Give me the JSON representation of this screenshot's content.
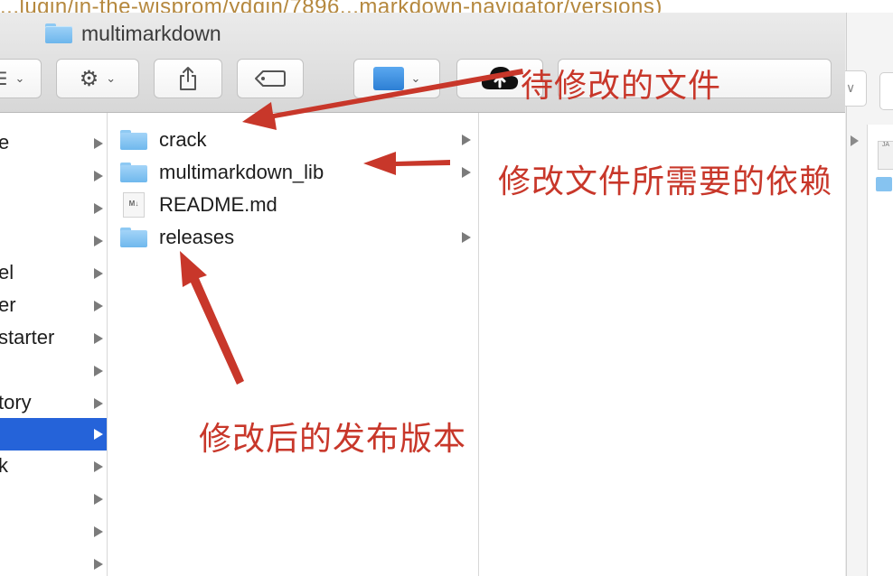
{
  "background": {
    "url_text": "...lugin/in-the-wisprom/ydqin/7896...markdown-navigator/versions)",
    "right_button_glyph": "∨",
    "jar_label": "JA"
  },
  "window": {
    "title": "multimarkdown",
    "toolbar": {
      "view_glyph": "☰",
      "action_icon": "gear-icon",
      "share_icon": "share-icon",
      "tags_icon": "tag-icon",
      "box_icon": "box-folder-icon",
      "cloud_icon": "cloud-upload-icon",
      "chevron": "⌄"
    },
    "sidebar": {
      "items": [
        {
          "label": "e"
        },
        {
          "label": ""
        },
        {
          "label": ""
        },
        {
          "label": ""
        },
        {
          "label": "el"
        },
        {
          "label": "er"
        },
        {
          "label": "starter"
        },
        {
          "label": ""
        },
        {
          "label": "tory"
        },
        {
          "label": "",
          "selected": true
        },
        {
          "label": "k"
        },
        {
          "label": ""
        },
        {
          "label": ""
        },
        {
          "label": ""
        }
      ]
    },
    "files": [
      {
        "name": "crack",
        "type": "folder",
        "has_children": true
      },
      {
        "name": "multimarkdown_lib",
        "type": "folder",
        "has_children": true
      },
      {
        "name": "README.md",
        "type": "markdown-file",
        "has_children": false,
        "icon_text": "M↓"
      },
      {
        "name": "releases",
        "type": "folder",
        "has_children": true
      }
    ]
  },
  "annotations": {
    "color": "#c8372a",
    "note_files_to_modify": "待修改的文件",
    "note_dependencies": "修改文件所需要的依赖",
    "note_releases": "修改后的发布版本"
  }
}
